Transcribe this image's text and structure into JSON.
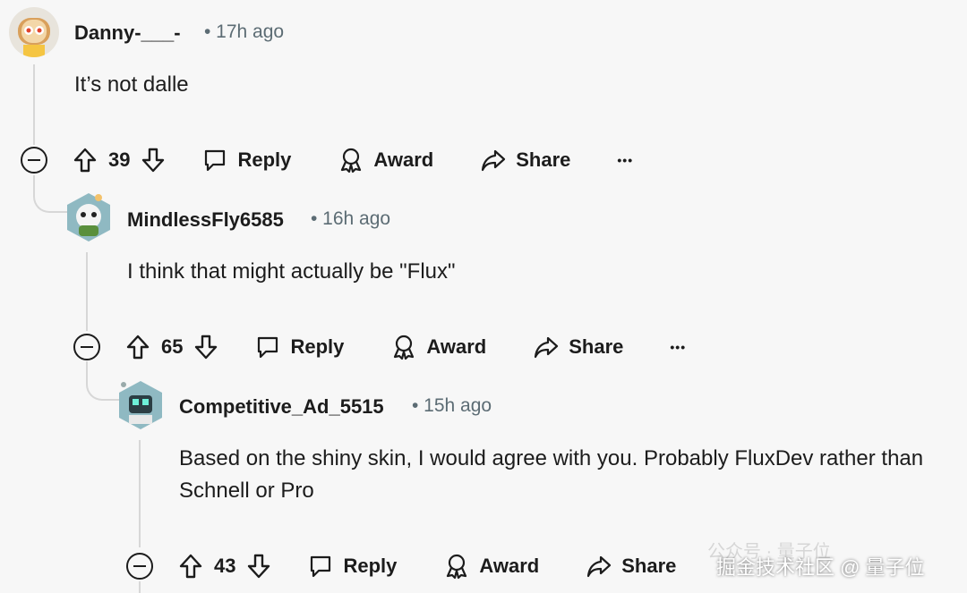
{
  "comments": [
    {
      "username": "Danny-___-",
      "time": "• 17h ago",
      "text": "It’s not dalle",
      "votes": "39"
    },
    {
      "username": "MindlessFly6585",
      "time": "• 16h ago",
      "text": "I think that might actually be \"Flux\"",
      "votes": "65"
    },
    {
      "username": "Competitive_Ad_5515",
      "time": "• 15h ago",
      "text": "Based on the shiny skin, I would agree with you. Probably FluxDev rather than Schnell or Pro",
      "votes": "43"
    }
  ],
  "labels": {
    "reply": "Reply",
    "award": "Award",
    "share": "Share",
    "more": "•••"
  },
  "watermark": {
    "line1": "公众号 · 量子位",
    "line2": "掘金技术社区 @ 量子位"
  }
}
